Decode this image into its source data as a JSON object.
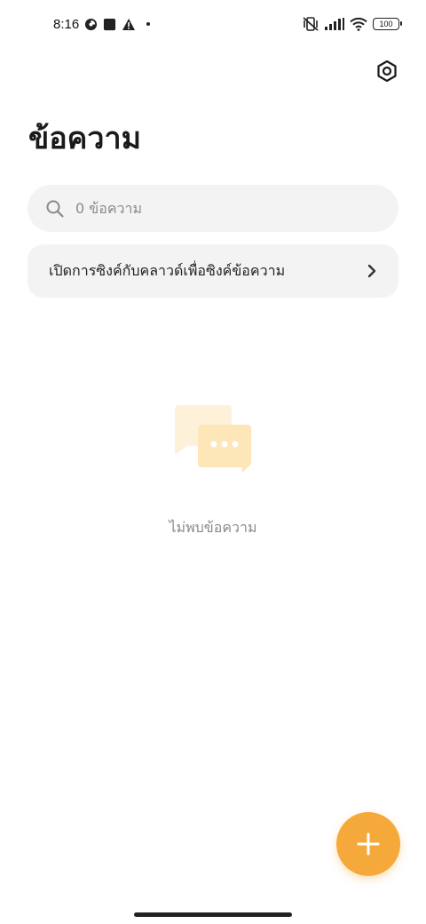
{
  "status_bar": {
    "time": "8:16",
    "battery": "100",
    "icons": [
      "data-saver-icon",
      "square-notification-icon",
      "warning-icon",
      "dot-icon",
      "mute-vibrate-icon",
      "signal-icon",
      "wifi-icon",
      "battery-icon"
    ]
  },
  "header": {
    "title": "ข้อความ",
    "settings_icon": "settings-hexagon-icon"
  },
  "search": {
    "placeholder": "0 ข้อความ",
    "value": ""
  },
  "sync": {
    "label": "เปิดการซิงค์กับคลาวด์เพื่อซิงค์ข้อความ"
  },
  "empty_state": {
    "message": "ไม่พบข้อความ",
    "icon": "chat-bubbles-icon"
  },
  "fab": {
    "icon": "plus-icon"
  },
  "colors": {
    "accent": "#f6a93b",
    "surface": "#f3f3f3",
    "illustration_light": "#fdf1d9",
    "illustration": "#fde6b8"
  }
}
